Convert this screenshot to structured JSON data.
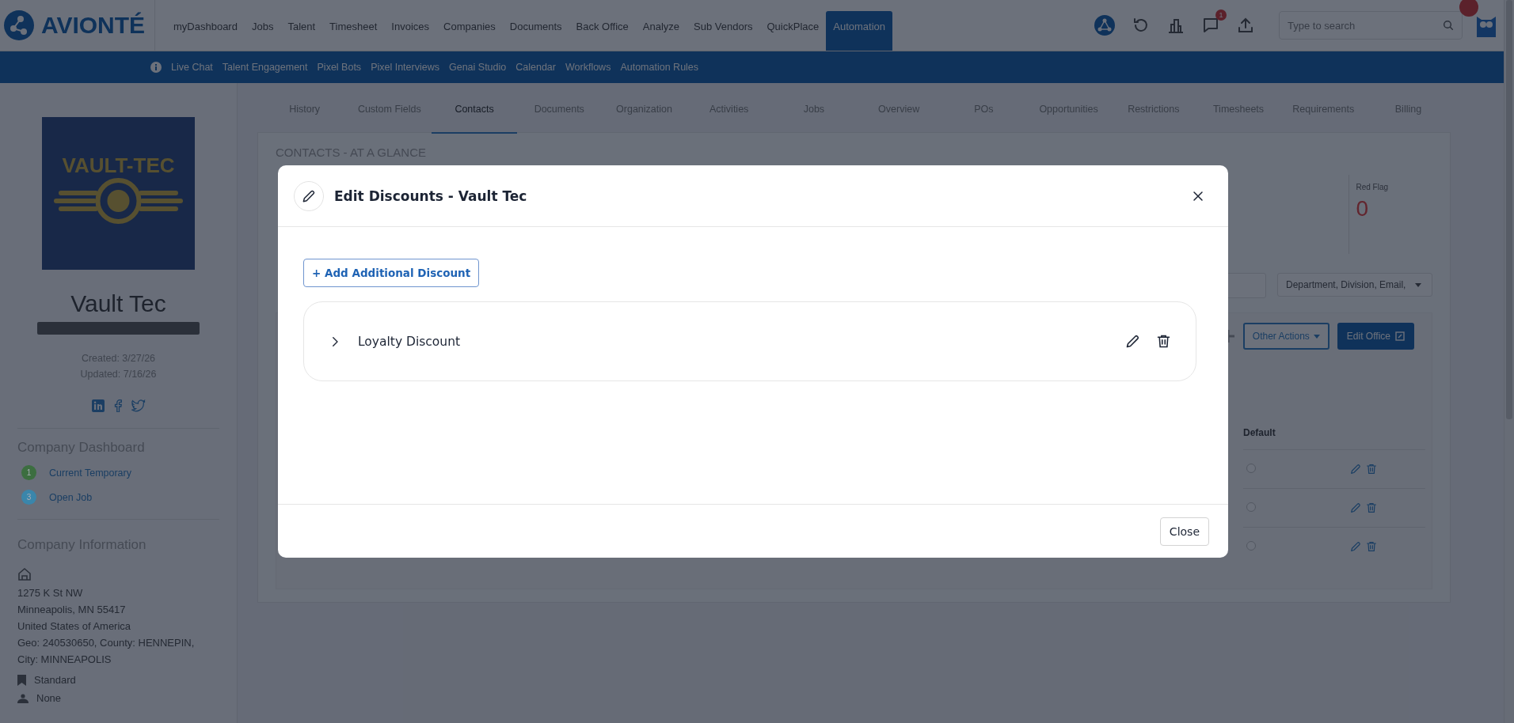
{
  "top_nav": {
    "logo": "AVIONTÉ",
    "items": [
      {
        "label": "myDashboard",
        "selected": false
      },
      {
        "label": "Jobs",
        "selected": false
      },
      {
        "label": "Talent",
        "selected": false
      },
      {
        "label": "Timesheet",
        "selected": false
      },
      {
        "label": "Invoices",
        "selected": false
      },
      {
        "label": "Companies",
        "selected": false
      },
      {
        "label": "Documents",
        "selected": false
      },
      {
        "label": "Back Office",
        "selected": false
      },
      {
        "label": "Analyze",
        "selected": false
      },
      {
        "label": "Sub Vendors",
        "selected": false
      },
      {
        "label": "QuickPlace",
        "selected": false
      },
      {
        "label": "Automation",
        "selected": true
      }
    ],
    "chat_badge": "1",
    "search": {
      "placeholder": "Type to search"
    }
  },
  "sub_nav": {
    "items": [
      "Live Chat",
      "Talent Engagement",
      "Pixel Bots",
      "Pixel Interviews",
      "Genai Studio",
      "Calendar",
      "Workflows",
      "Automation Rules"
    ]
  },
  "sidebar": {
    "logo_text": "VAULT-TEC",
    "company_name": "Vault Tec",
    "created": "Created: 3/27/26",
    "updated": "Updated: 7/16/26",
    "dashboard": {
      "title": "Company Dashboard",
      "items": [
        {
          "count": "1",
          "label": "Current Temporary",
          "color": "#3c6e40"
        },
        {
          "count": "3",
          "label": "Open Job",
          "color": "#3a86ab"
        }
      ]
    },
    "info": {
      "title": "Company Information",
      "address_lines": [
        "1275 K St NW",
        "Minneapolis, MN 55417",
        "United States of America",
        "Geo: 240530650, County: HENNEPIN,",
        "City: MINNEAPOLIS"
      ],
      "details": [
        {
          "kind": "book",
          "label": "Standard"
        },
        {
          "kind": "person",
          "label": "None"
        }
      ]
    }
  },
  "tabs": [
    {
      "label": "History",
      "selected": false
    },
    {
      "label": "Custom Fields",
      "selected": false
    },
    {
      "label": "Contacts",
      "selected": true
    },
    {
      "label": "Documents",
      "selected": false
    },
    {
      "label": "Organization",
      "selected": false
    },
    {
      "label": "Activities",
      "selected": false
    },
    {
      "label": "Jobs",
      "selected": false
    },
    {
      "label": "Overview",
      "selected": false
    },
    {
      "label": "POs",
      "selected": false
    },
    {
      "label": "Opportunities",
      "selected": false
    },
    {
      "label": "Restrictions",
      "selected": false
    },
    {
      "label": "Timesheets",
      "selected": false
    },
    {
      "label": "Requirements",
      "selected": false
    },
    {
      "label": "Billing",
      "selected": false
    }
  ],
  "content": {
    "section_title": "CONTACTS - AT A GLANCE",
    "red_flag": {
      "label": "Red Flag",
      "value": "0"
    },
    "filter": "Department, Division, Email,",
    "buttons": [
      {
        "kind": "outline",
        "label": "Other Actions"
      },
      {
        "kind": "primary",
        "label": "Edit Office"
      }
    ],
    "table": {
      "columns": [
        "Default"
      ],
      "rows": [
        {
          "default": false
        },
        {
          "default": false
        },
        {
          "default": false
        }
      ]
    }
  },
  "modal": {
    "title": "Edit Discounts - Vault Tec",
    "add_button": "+ Add Additional Discount",
    "discounts": [
      {
        "name": "Loyalty Discount",
        "expanded": false
      }
    ],
    "close_button": "Close"
  }
}
